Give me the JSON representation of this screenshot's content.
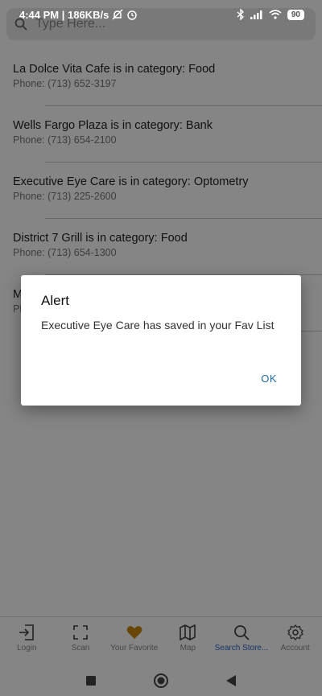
{
  "status_bar": {
    "time_speed": "4:44 PM | 186KB/s",
    "battery": "90"
  },
  "search": {
    "placeholder": "Type Here..."
  },
  "stores": [
    {
      "title": "La Dolce Vita Cafe is in category:  Food",
      "phone": "Phone: (713) 652-3197"
    },
    {
      "title": "Wells Fargo Plaza is in category:  Bank",
      "phone": "Phone: (713) 654-2100"
    },
    {
      "title": "Executive Eye Care is in category:  Optometry",
      "phone": "Phone: (713) 225-2600"
    },
    {
      "title": "District 7 Grill is in category:  Food",
      "phone": "Phone: (713) 654-1300"
    },
    {
      "title": "M",
      "phone": "Ph"
    }
  ],
  "dialog": {
    "title": "Alert",
    "message": "Executive Eye Care has saved in your Fav List",
    "ok_label": "OK"
  },
  "tabs": [
    {
      "label": "Login",
      "icon": "login-icon"
    },
    {
      "label": "Scan",
      "icon": "scan-icon"
    },
    {
      "label": "Your Favorite",
      "icon": "heart-icon"
    },
    {
      "label": "Map",
      "icon": "map-icon"
    },
    {
      "label": "Search Store...",
      "icon": "search-icon",
      "active": true
    },
    {
      "label": "Account",
      "icon": "gear-icon"
    }
  ],
  "colors": {
    "active_tab": "#2f64c8",
    "favorite_heart": "#c8860a",
    "dialog_button": "#1e6ba6"
  }
}
